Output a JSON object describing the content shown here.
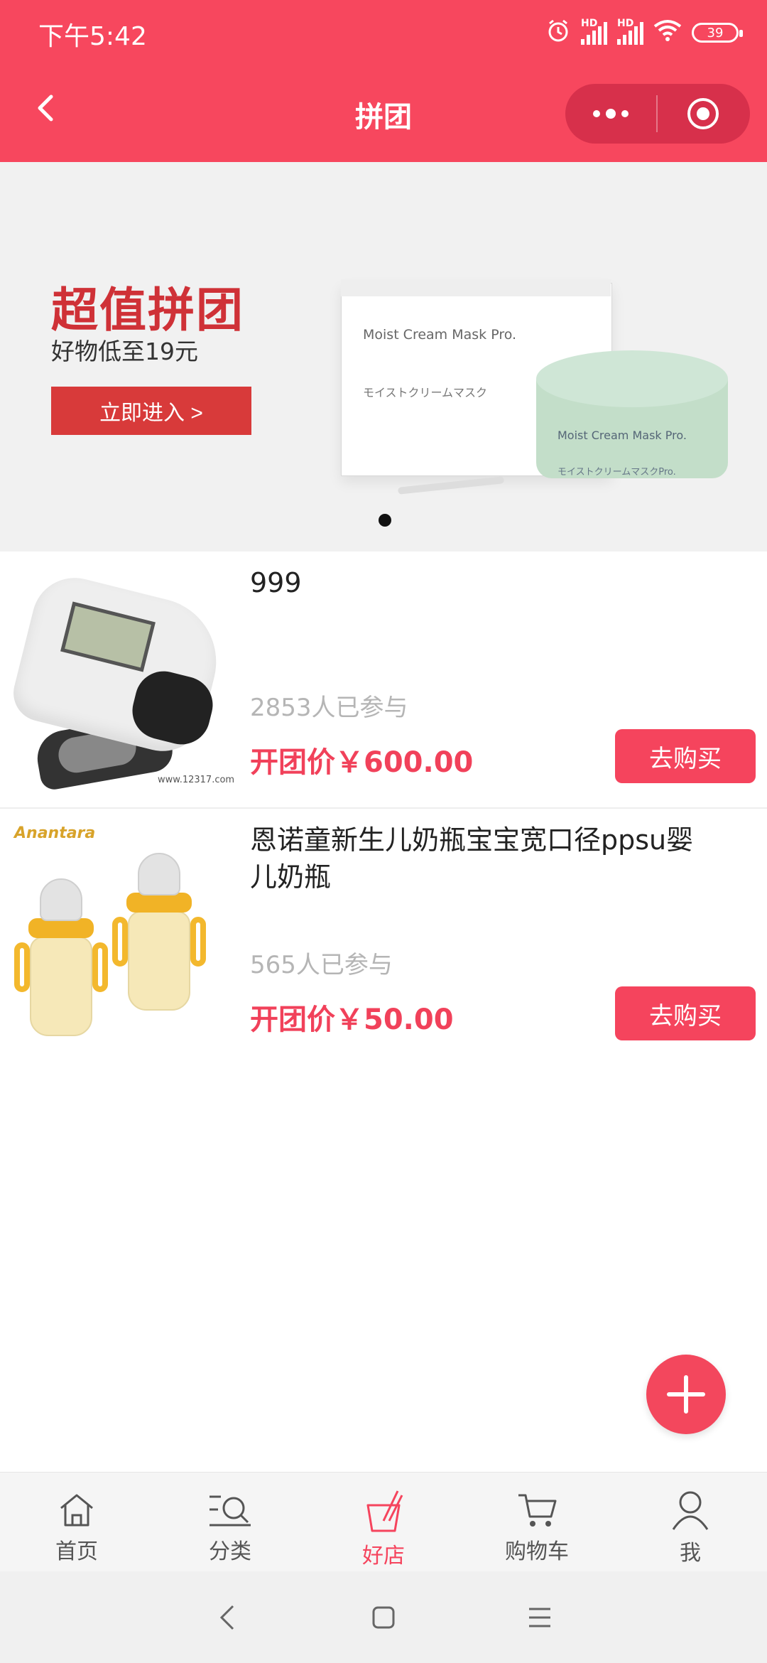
{
  "status_bar": {
    "time": "下午5:42",
    "battery": "39",
    "signal1_label": "HD",
    "signal2_label": "HD",
    "icons": [
      "alarm-icon",
      "signal-icon",
      "signal-icon",
      "wifi-icon",
      "battery-icon"
    ]
  },
  "header": {
    "title": "拼团",
    "background": "#f7475e",
    "back_icon": "chevron-left-icon",
    "more_icon": "more-dots-icon",
    "close_icon": "target-circle-icon"
  },
  "banner": {
    "title": "超值拼团",
    "subtitle": "好物低至19元",
    "button_label": "立即进入 >",
    "box_text": "Moist Cream Mask Pro.",
    "box_subtext": "モイストクリームマスク",
    "jar_text": "Moist Cream Mask Pro.",
    "jar_subtext": "モイストクリームマスクPro.",
    "active_dot": 0,
    "dot_count": 1
  },
  "products": [
    {
      "title": "999",
      "joined": "2853人已参与",
      "price": "开团价￥600.00",
      "buy_label": "去购买",
      "watermark": "www.12317.com"
    },
    {
      "title": "恩诺童新生儿奶瓶宝宝宽口径ppsu婴儿奶瓶",
      "joined": "565人已参与",
      "price": "开团价￥50.00",
      "buy_label": "去购买",
      "brand": "Anantara"
    }
  ],
  "fab": {
    "icon": "plus-icon"
  },
  "tabbar": {
    "active_color": "#f5445d",
    "items": [
      {
        "label": "首页",
        "icon": "home-icon"
      },
      {
        "label": "分类",
        "icon": "category-search-icon"
      },
      {
        "label": "好店",
        "icon": "shop-cup-icon",
        "active": true
      },
      {
        "label": "购物车",
        "icon": "cart-icon"
      },
      {
        "label": "我",
        "icon": "user-icon"
      }
    ]
  },
  "system_nav": {
    "icons": [
      "back-icon",
      "home-square-icon",
      "menu-icon"
    ]
  }
}
